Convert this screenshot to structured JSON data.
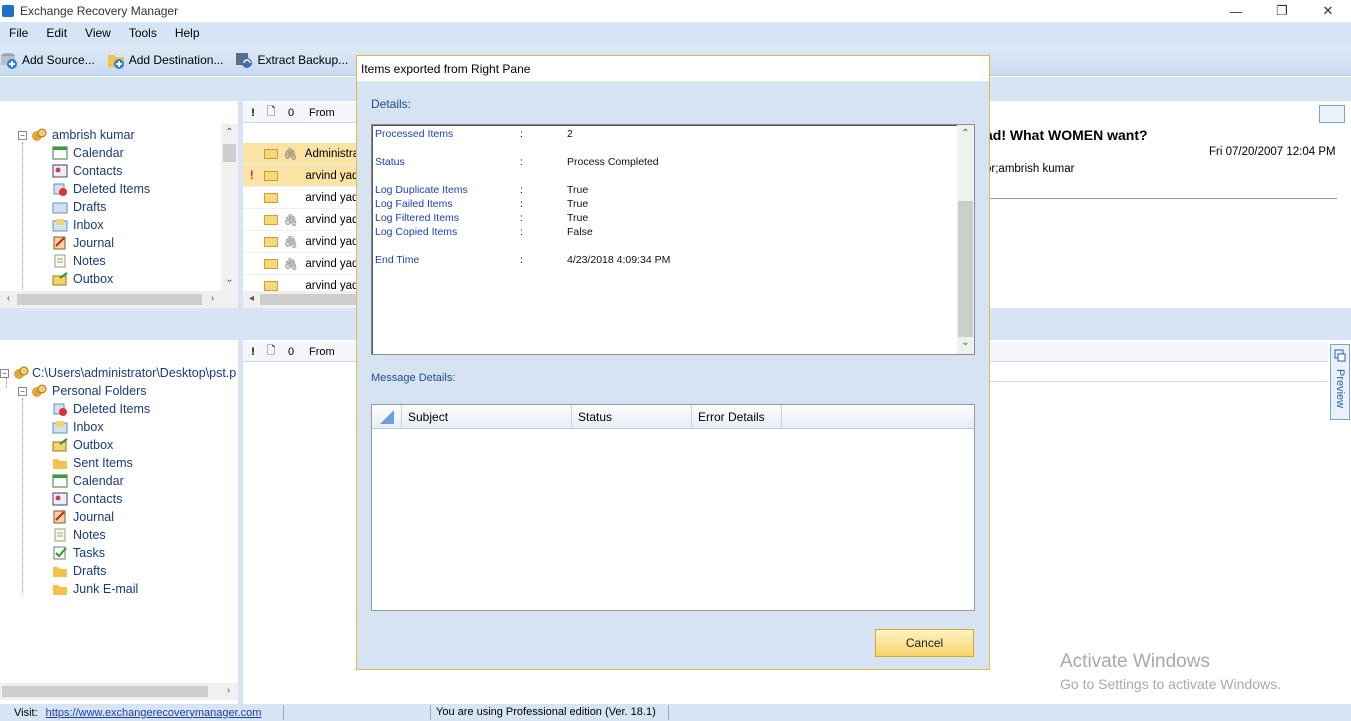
{
  "window": {
    "title": "Exchange Recovery Manager",
    "minimize": "—",
    "maximize": "❐",
    "close": "✕"
  },
  "menu": [
    "File",
    "Edit",
    "View",
    "Tools",
    "Help"
  ],
  "toolbar": {
    "add_source": "Add Source...",
    "add_destination": "Add Destination...",
    "extract_backup": "Extract Backup...",
    "truncated_fourth": "E"
  },
  "source_tree": {
    "root": "ambrish kumar",
    "items": [
      "Calendar",
      "Contacts",
      "Deleted Items",
      "Drafts",
      "Inbox",
      "Journal",
      "Notes",
      "Outbox"
    ]
  },
  "dest_tree": {
    "path": "C:\\Users\\administrator\\Desktop\\pst.p",
    "root": "Personal Folders",
    "items": [
      "Deleted Items",
      "Inbox",
      "Outbox",
      "Sent Items",
      "Calendar",
      "Contacts",
      "Journal",
      "Notes",
      "Tasks",
      "Drafts",
      "Junk E-mail"
    ]
  },
  "message_list": {
    "col_flag": "!",
    "col_type": "🗋",
    "col_attach": "0",
    "col_from": "From",
    "rows": [
      {
        "from": "Administra",
        "attach": true,
        "important": false,
        "selected": true
      },
      {
        "from": "arvind yad",
        "attach": false,
        "important": true,
        "selected": false,
        "highlight": true
      },
      {
        "from": "arvind yad",
        "attach": false,
        "important": false
      },
      {
        "from": "arvind yad",
        "attach": true,
        "important": false
      },
      {
        "from": "arvind yad",
        "attach": true,
        "important": false
      },
      {
        "from": "arvind yad",
        "attach": true,
        "important": false
      },
      {
        "from": "arvind yad",
        "attach": false,
        "important": false
      }
    ]
  },
  "dest_list": {
    "col_flag": "!",
    "col_type": "🗋",
    "col_attach": "0",
    "col_from": "From"
  },
  "preview": {
    "subject": "ad! What WOMEN want?",
    "date": "Fri 07/20/2007 12:04 PM",
    "to": "or;ambrish kumar",
    "tab_label": "Preview"
  },
  "dialog": {
    "title": "Items exported from Right Pane",
    "details_label": "Details:",
    "details": [
      {
        "key": "Processed Items",
        "sep": ":",
        "value": "2"
      },
      {
        "key": "Status",
        "sep": ":",
        "value": "Process Completed"
      },
      {
        "key": "Log Duplicate Items",
        "sep": ":",
        "value": "True"
      },
      {
        "key": "Log Failed Items",
        "sep": ":",
        "value": "True"
      },
      {
        "key": "Log Filtered Items",
        "sep": ":",
        "value": "True"
      },
      {
        "key": "Log Copied Items",
        "sep": ":",
        "value": "False"
      },
      {
        "key": "End Time",
        "sep": ":",
        "value": "4/23/2018 4:09:34 PM"
      }
    ],
    "message_details_label": "Message Details:",
    "grid_columns": [
      "Subject",
      "Status",
      "Error Details"
    ],
    "cancel": "Cancel"
  },
  "status": {
    "visit_label": "Visit:",
    "url": "https://www.exchangerecoverymanager.com",
    "edition": "You are using Professional edition (Ver. 18.1)"
  },
  "watermark": {
    "line1": "Activate Windows",
    "line2": "Go to Settings to activate Windows."
  },
  "colors": {
    "accent": "#d6e3f3",
    "button": "#f8d56a",
    "link": "#1f3fb5"
  }
}
